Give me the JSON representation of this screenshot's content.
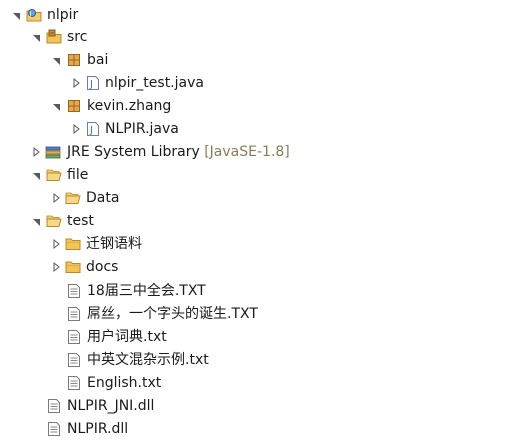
{
  "tree": {
    "project": "nlpir",
    "src": "src",
    "pkg_bai": "bai",
    "file_nlpir_test": "nlpir_test.java",
    "pkg_kevin": "kevin.zhang",
    "file_nlpir_java": "NLPIR.java",
    "jre_label": "JRE System Library",
    "jre_decoration": "[JavaSE-1.8]",
    "folder_file": "file",
    "folder_data": "Data",
    "folder_test": "test",
    "folder_qiangang": "迁钢语料",
    "folder_docs": "docs",
    "file_txt1": "18届三中全会.TXT",
    "file_txt2": "屌丝，一个字头的诞生.TXT",
    "file_txt3": "用户词典.txt",
    "file_txt4": "中英文混杂示例.txt",
    "file_txt5": "English.txt",
    "file_dll1": "NLPIR_JNI.dll",
    "file_dll2": "NLPIR.dll"
  },
  "icons": {
    "twisty_expanded": "triangle-down-icon",
    "twisty_collapsed": "triangle-right-icon",
    "project": "java-project-icon",
    "source_folder": "source-folder-icon",
    "package": "package-icon",
    "java_file": "java-file-icon",
    "library": "library-icon",
    "folder_open": "folder-open-icon",
    "folder": "folder-icon",
    "text_file": "text-file-icon"
  },
  "colors": {
    "background": "#ffffff",
    "text": "#1a1a1a",
    "decoration": "#8a7a58",
    "folder": "#e8b64a",
    "package": "#b07a2c",
    "java_blue": "#4a6fb5",
    "twisty": "#5a5a5a"
  }
}
